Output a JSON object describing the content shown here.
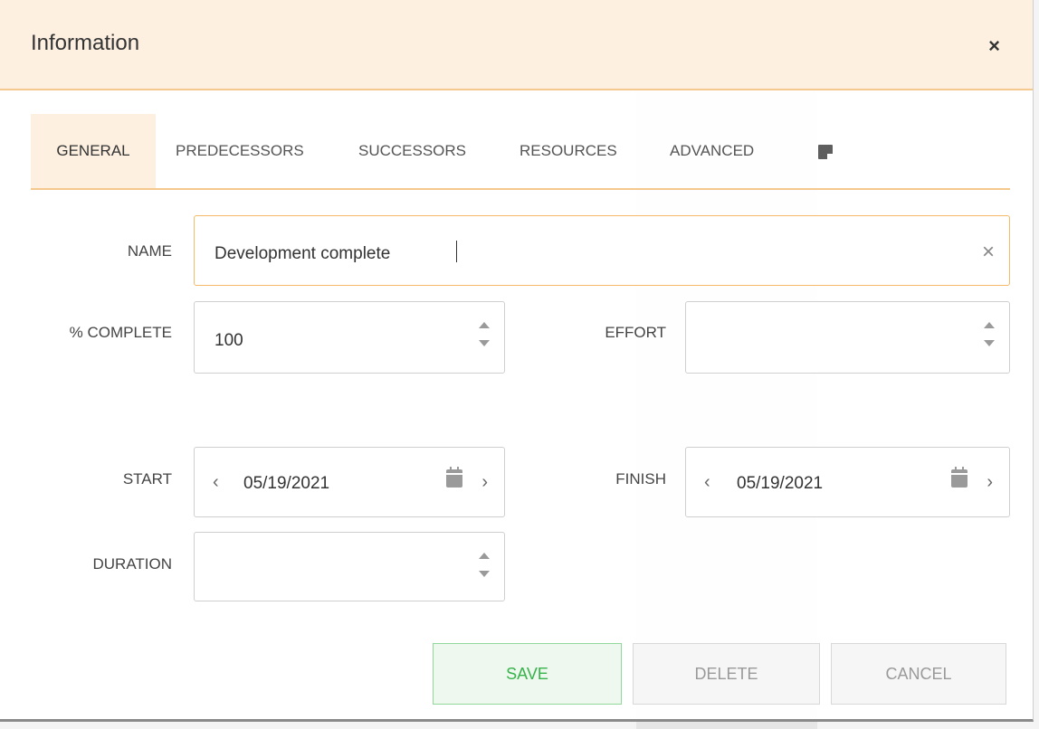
{
  "dialog": {
    "title": "Information",
    "close_label": "×"
  },
  "tabs": [
    {
      "label": "GENERAL",
      "active": true
    },
    {
      "label": "PREDECESSORS",
      "active": false
    },
    {
      "label": "SUCCESSORS",
      "active": false
    },
    {
      "label": "RESOURCES",
      "active": false
    },
    {
      "label": "ADVANCED",
      "active": false
    }
  ],
  "form": {
    "name": {
      "label": "NAME",
      "value": "Development complete",
      "clear_label": "×"
    },
    "percent_complete": {
      "label": "% COMPLETE",
      "value": "100"
    },
    "effort": {
      "label": "EFFORT",
      "value": ""
    },
    "start": {
      "label": "START",
      "value": "05/19/2021"
    },
    "finish": {
      "label": "FINISH",
      "value": "05/19/2021"
    },
    "duration": {
      "label": "DURATION",
      "value": ""
    }
  },
  "buttons": {
    "save": "SAVE",
    "delete": "DELETE",
    "cancel": "CANCEL"
  },
  "colors": {
    "header_bg": "#fdf0e1",
    "accent_border": "#f5c98d",
    "save_green": "#36b34a"
  }
}
